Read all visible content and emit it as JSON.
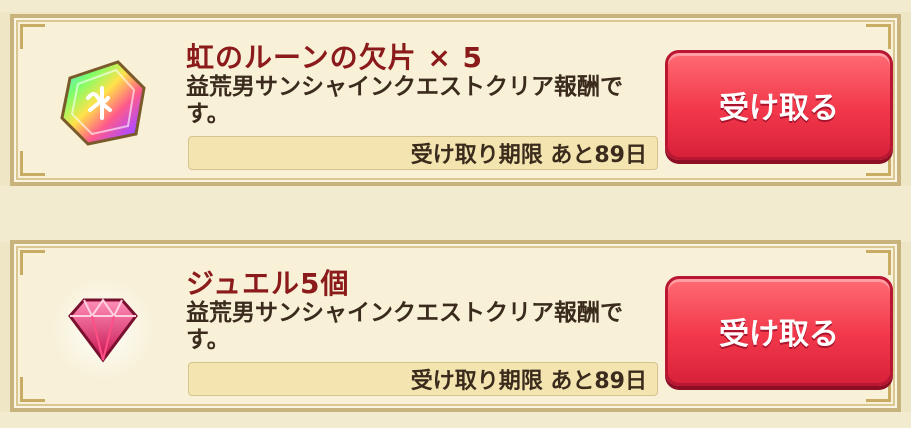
{
  "rewards": [
    {
      "icon": "rainbow-rune-fragment-icon",
      "title": "虹のルーンの欠片 × 5",
      "description": "益荒男サンシャインクエストクリア報酬です。",
      "deadline": "受け取り期限 あと89日",
      "button_label": "受け取る"
    },
    {
      "icon": "pink-jewel-icon",
      "title": "ジュエル5個",
      "description": "益荒男サンシャインクエストクリア報酬です。",
      "deadline": "受け取り期限 あと89日",
      "button_label": "受け取る"
    }
  ],
  "colors": {
    "title": "#8b1a1a",
    "button": "#f2374a",
    "card_border": "#c9b37c",
    "background": "#efe6c6"
  }
}
